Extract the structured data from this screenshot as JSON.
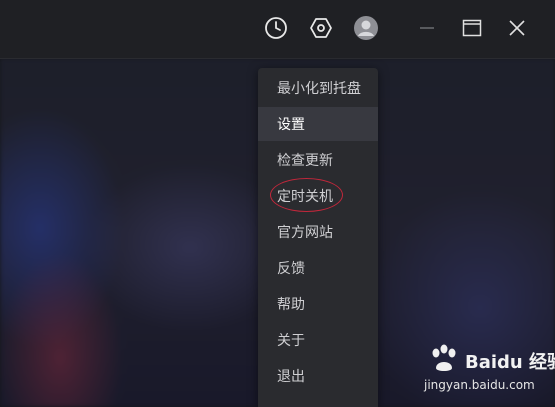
{
  "titlebar": {
    "icons": [
      "clock-icon",
      "hexagon-settings-icon",
      "user-avatar-icon",
      "minimize-icon",
      "maximize-icon",
      "close-icon"
    ]
  },
  "menu": {
    "items": [
      {
        "label": "最小化到托盘",
        "active": false
      },
      {
        "label": "设置",
        "active": true
      },
      {
        "label": "检查更新",
        "active": false
      },
      {
        "label": "定时关机",
        "active": false,
        "highlighted": true
      },
      {
        "label": "官方网站",
        "active": false
      },
      {
        "label": "反馈",
        "active": false
      },
      {
        "label": "帮助",
        "active": false
      },
      {
        "label": "关于",
        "active": false
      },
      {
        "label": "退出",
        "active": false
      }
    ]
  },
  "annotation": {
    "color": "#c1273b"
  },
  "watermark": {
    "title": "Baidu 经验",
    "url": "jingyan.baidu.com"
  }
}
